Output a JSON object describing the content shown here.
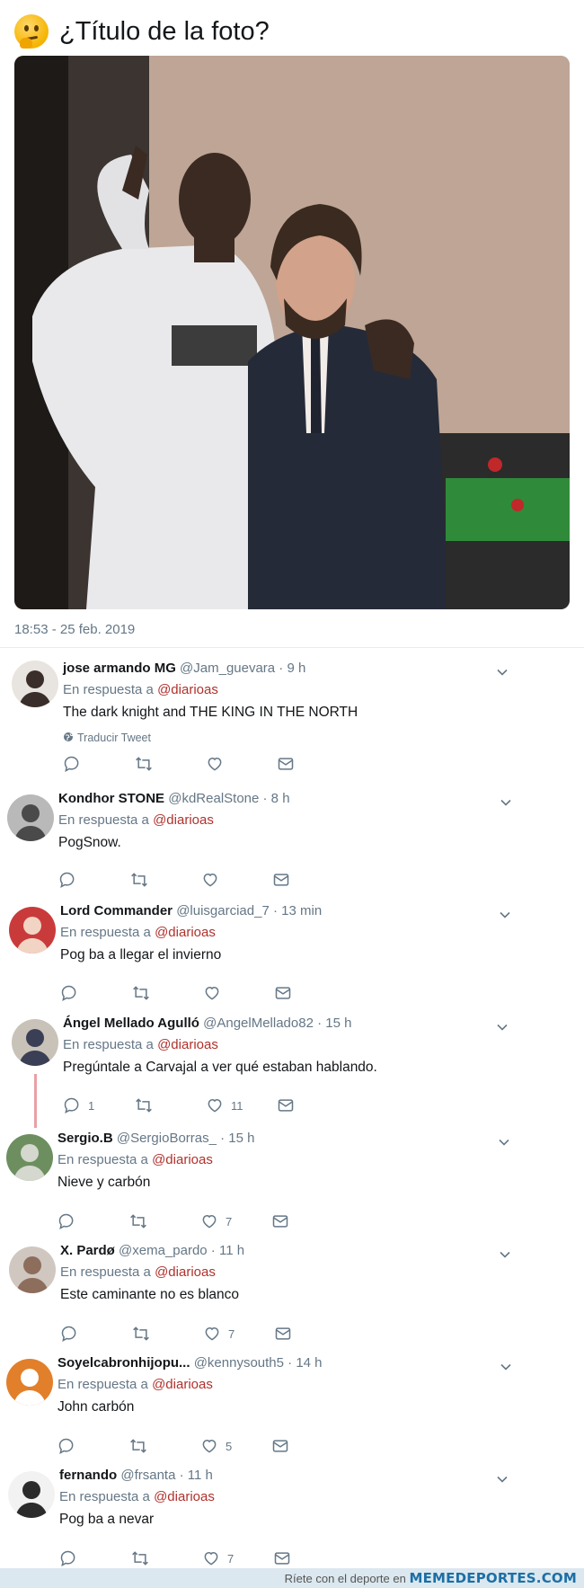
{
  "tweet": {
    "title": "¿Título de la foto?",
    "emoji": "thinking-face-icon",
    "photo": "photo-two-men-posing",
    "timestamp": "18:53 - 25 feb. 2019"
  },
  "colors": {
    "mention": "#b0312c",
    "muted": "#657786",
    "thread_line": "#e9a0a7"
  },
  "replies": [
    {
      "name": "jose armando MG",
      "meta": "@Jam_guevara · 9 h",
      "reply_label": "En respuesta a ",
      "mention": "@diarioas",
      "text": "The dark knight and THE KING IN THE NORTH",
      "translate": "Traducir Tweet",
      "replies_count": "",
      "likes_count": ""
    },
    {
      "name": "Kondhor STONE",
      "meta": "@kdRealStone · 8 h",
      "reply_label": "En respuesta a ",
      "mention": "@diarioas",
      "text": "PogSnow.",
      "replies_count": "",
      "likes_count": ""
    },
    {
      "name": "Lord Commander",
      "meta": "@luisgarciad_7 · 13 min",
      "reply_label": "En respuesta a ",
      "mention": "@diarioas",
      "text": "Pog ba a llegar el invierno",
      "replies_count": "",
      "likes_count": ""
    },
    {
      "name": "Ángel Mellado Agulló",
      "meta": "@AngelMellado82 · 15 h",
      "reply_label": "En respuesta a ",
      "mention": "@diarioas",
      "text": "Pregúntale a Carvajal a ver qué estaban hablando.",
      "replies_count": "1",
      "likes_count": "11"
    },
    {
      "name": "Sergio.B",
      "meta": "@SergioBorras_ · 15 h",
      "reply_label": "En respuesta a ",
      "mention": "@diarioas",
      "text": "Nieve y carbón",
      "replies_count": "",
      "likes_count": "7"
    },
    {
      "name": "X. Pardø",
      "meta": "@xema_pardo · 11 h",
      "reply_label": "En respuesta a ",
      "mention": "@diarioas",
      "text": "Este caminante no es blanco",
      "replies_count": "",
      "likes_count": "7"
    },
    {
      "name": "Soyelcabronhijopu...",
      "meta": "@kennysouth5 · 14 h",
      "reply_label": "En respuesta a ",
      "mention": "@diarioas",
      "text": "John carbón",
      "replies_count": "",
      "likes_count": "5"
    },
    {
      "name": "fernando",
      "meta": "@frsanta · 11 h",
      "reply_label": "En respuesta a ",
      "mention": "@diarioas",
      "text": "Pog ba a nevar",
      "replies_count": "",
      "likes_count": "7"
    }
  ],
  "footer": {
    "prefix": "Ríete con el deporte en",
    "brand": "MEMEDEPORTES.COM"
  }
}
